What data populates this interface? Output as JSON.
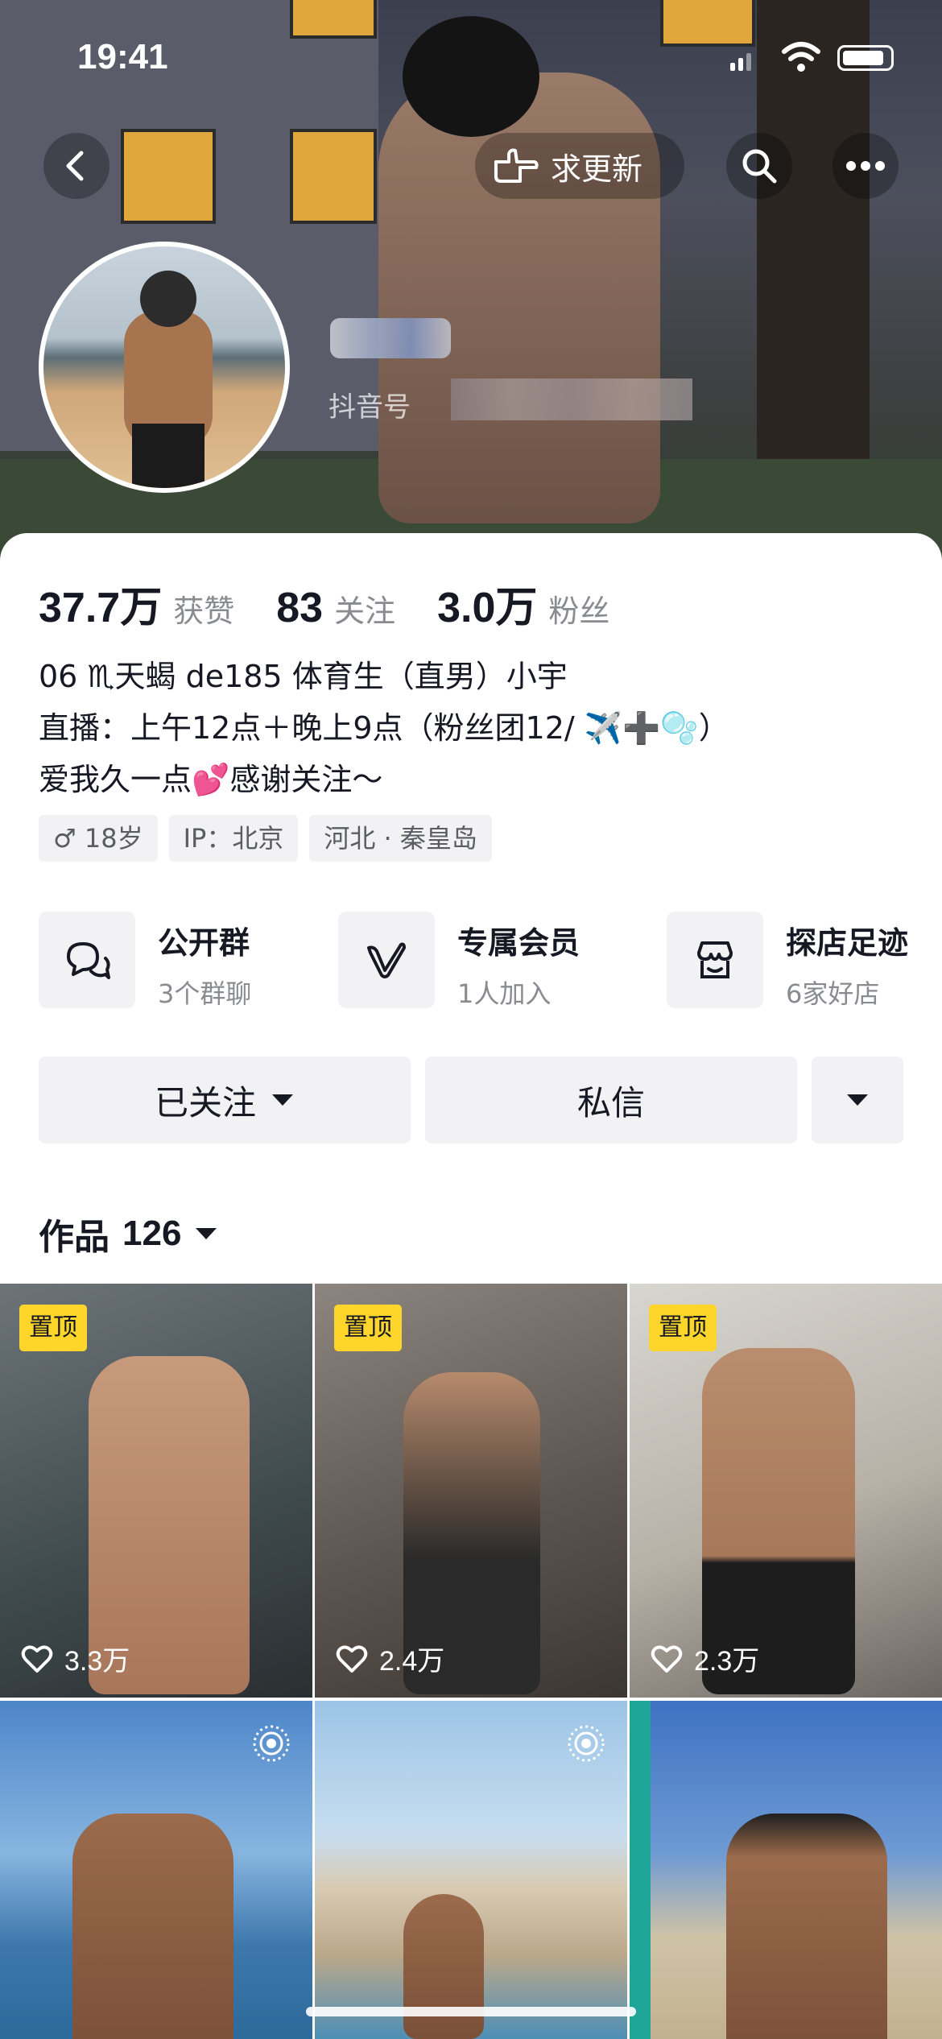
{
  "status_bar": {
    "time": "19:41"
  },
  "header": {
    "request_update_label": "求更新",
    "douyin_id_label": "抖音号"
  },
  "stats": [
    {
      "value": "37.7万",
      "label": "获赞"
    },
    {
      "value": "83",
      "label": "关注"
    },
    {
      "value": "3.0万",
      "label": "粉丝"
    }
  ],
  "bio": {
    "line1": "06 ♏天蝎 de185 体育生（直男）小宇",
    "line2": "直播：上午12点＋晚上9点（粉丝团12/ ✈️➕🫧）",
    "line3": "爱我久一点💕感谢关注～"
  },
  "tags": {
    "gender_age": "♂ 18岁",
    "ip": "IP：北京",
    "location": "河北 · 秦皇岛"
  },
  "features": [
    {
      "title": "公开群",
      "subtitle": "3个群聊",
      "icon": "group-chat-icon"
    },
    {
      "title": "专属会员",
      "subtitle": "1人加入",
      "icon": "vip-v-icon"
    },
    {
      "title": "探店足迹",
      "subtitle": "6家好店",
      "icon": "shop-icon"
    }
  ],
  "actions": {
    "following_label": "已关注",
    "message_label": "私信"
  },
  "works": {
    "label": "作品",
    "count": "126"
  },
  "videos": [
    {
      "pinned_label": "置顶",
      "likes": "3.3万"
    },
    {
      "pinned_label": "置顶",
      "likes": "2.4万"
    },
    {
      "pinned_label": "置顶",
      "likes": "2.3万"
    }
  ],
  "colors": {
    "pin_badge": "#fdd52b",
    "text_primary": "#161823",
    "text_secondary": "#8a8b91",
    "button_bg": "#f2f2f4"
  }
}
